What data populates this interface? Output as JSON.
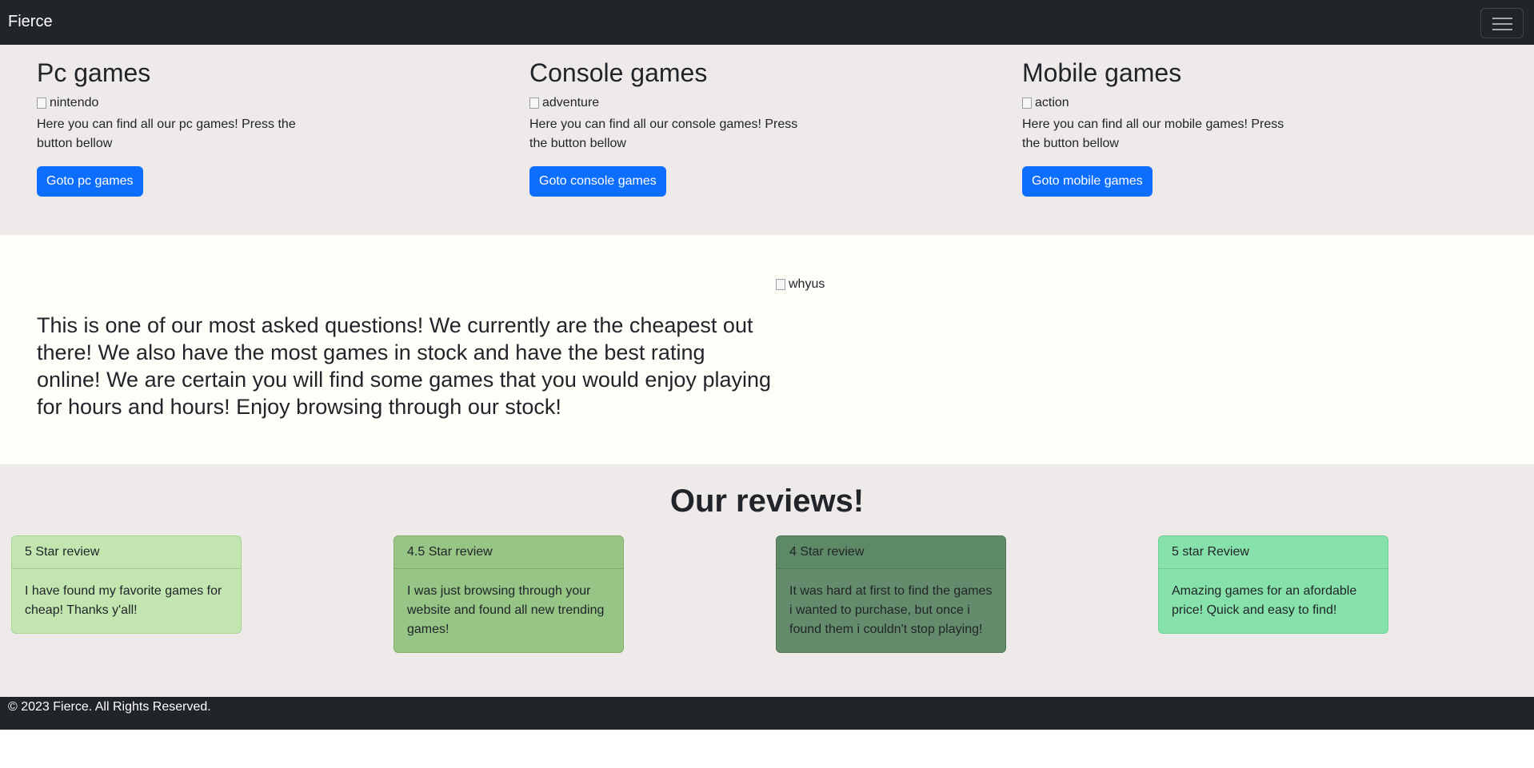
{
  "navbar": {
    "brand": "Fierce",
    "toggler_icon": "hamburger-menu-icon"
  },
  "games": [
    {
      "title": "Pc games",
      "img_alt": "nintendo",
      "text": "Here you can find all our pc games! Press the button bellow",
      "button": "Goto pc games"
    },
    {
      "title": "Console games",
      "img_alt": "adventure",
      "text": "Here you can find all our console games! Press the button bellow",
      "button": "Goto console games"
    },
    {
      "title": "Mobile games",
      "img_alt": "action",
      "text": "Here you can find all our mobile games! Press the button bellow",
      "button": "Goto mobile games"
    }
  ],
  "why": {
    "img_alt": "whyus",
    "text": "This is one of our most asked questions! We currently are the cheapest out there! We also have the most games in stock and have the best rating online! We are certain you will find some games that you would enjoy playing for hours and hours! Enjoy browsing through our stock!"
  },
  "reviews": {
    "heading": "Our reviews!",
    "cards": [
      {
        "header": "5 Star review",
        "body": "I have found my favorite games for cheap! Thanks y'all!",
        "bg": "#c3e6b1",
        "border": "#a7d493",
        "hdr_bg": "#c3e6b1"
      },
      {
        "header": "4.5 Star review",
        "body": "I was just browsing through your website and found all new trending games!",
        "bg": "#97c585",
        "border": "#7fb06c",
        "hdr_bg": "#97c585"
      },
      {
        "header": "4 Star review",
        "body": "It was hard at first to find the games i wanted to purchase, but once i found them i couldn't stop playing!",
        "bg": "#648c6c",
        "border": "#4f7657",
        "hdr_bg": "#5e8967"
      },
      {
        "header": "5 star Review",
        "body": "Amazing games for an afordable price! Quick and easy to find!",
        "bg": "#86e2aa",
        "border": "#6dcf93",
        "hdr_bg": "#86e2aa"
      }
    ]
  },
  "footer": {
    "text": "© 2023 Fierce. All Rights Reserved."
  }
}
